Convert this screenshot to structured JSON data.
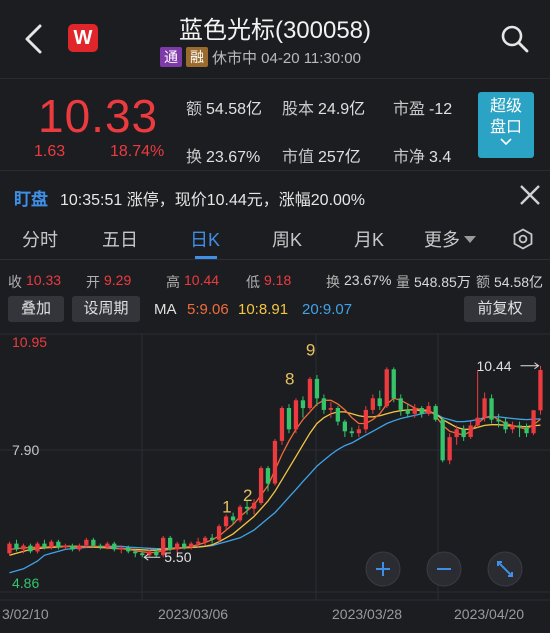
{
  "header": {
    "title": "蓝色光标(300058)",
    "logo": "W",
    "tags": [
      "通",
      "融"
    ],
    "status": "休市中 04-20 11:30:00"
  },
  "quote": {
    "price": "10.33",
    "change": "1.63",
    "change_pct": "18.74%",
    "stats": [
      {
        "label": "额",
        "value": "54.58亿"
      },
      {
        "label": "股本",
        "value": "24.9亿"
      },
      {
        "label": "市盈",
        "value": "-12"
      },
      {
        "label": "换",
        "value": "23.67%"
      },
      {
        "label": "市值",
        "value": "257亿"
      },
      {
        "label": "市净",
        "value": "3.4"
      }
    ],
    "super_button": [
      "超级",
      "盘口"
    ]
  },
  "watch": {
    "label": "盯盘",
    "text": "10:35:51 涨停，现价10.44元，涨幅20.00%"
  },
  "tabs": [
    "分时",
    "五日",
    "日K",
    "周K",
    "月K",
    "更多"
  ],
  "active_tab": "日K",
  "info": {
    "close_label": "收",
    "close": "10.33",
    "open_label": "开",
    "open": "9.29",
    "high_label": "高",
    "high": "10.44",
    "low_label": "低",
    "low": "9.18",
    "turnover_label": "换",
    "turnover": "23.67%",
    "volume_label": "量",
    "volume": "548.85万",
    "amount_label": "额",
    "amount": "54.58亿"
  },
  "controls": {
    "overlay_button": "叠加",
    "period_button": "设周期",
    "ma_label": "MA",
    "ma5": "5:9.06",
    "ma10": "10:8.91",
    "ma20": "20:9.07",
    "adjust_button": "前复权"
  },
  "colors": {
    "up": "#ec3b3f",
    "down": "#35c46a",
    "accent": "#3f8fe6",
    "ma5": "#f06d3a",
    "ma10": "#f5c542",
    "ma20": "#3fa3e8"
  },
  "chart_data": {
    "type": "candlestick",
    "y_labels": {
      "top": "10.95",
      "mid": "7.90",
      "bottom": "4.86"
    },
    "x_labels": [
      "3/02/10",
      "2023/03/06",
      "2023/03/28",
      "2023/04/20"
    ],
    "annotations": {
      "high_marker": "10.44",
      "low_marker": "5.50",
      "nine_turn": [
        "1",
        "2",
        "8",
        "9"
      ]
    },
    "ylim": [
      4.86,
      10.95
    ],
    "candles": [
      [
        5.6,
        5.85,
        5.55,
        5.9
      ],
      [
        5.85,
        5.7,
        5.65,
        5.95
      ],
      [
        5.7,
        5.8,
        5.6,
        5.85
      ],
      [
        5.8,
        5.65,
        5.6,
        5.85
      ],
      [
        5.65,
        5.85,
        5.6,
        5.9
      ],
      [
        5.85,
        5.75,
        5.7,
        5.95
      ],
      [
        5.75,
        5.9,
        5.7,
        5.95
      ],
      [
        5.9,
        5.75,
        5.7,
        5.95
      ],
      [
        5.75,
        5.8,
        5.7,
        5.85
      ],
      [
        5.8,
        5.7,
        5.65,
        5.85
      ],
      [
        5.7,
        5.8,
        5.65,
        5.85
      ],
      [
        5.8,
        5.95,
        5.75,
        6.0
      ],
      [
        5.95,
        5.8,
        5.75,
        6.0
      ],
      [
        5.8,
        5.75,
        5.7,
        5.85
      ],
      [
        5.75,
        5.85,
        5.7,
        5.9
      ],
      [
        5.85,
        5.7,
        5.65,
        5.9
      ],
      [
        5.7,
        5.75,
        5.6,
        5.8
      ],
      [
        5.75,
        5.65,
        5.6,
        5.8
      ],
      [
        5.65,
        5.6,
        5.5,
        5.7
      ],
      [
        5.6,
        5.55,
        5.5,
        5.65
      ],
      [
        5.55,
        5.65,
        5.5,
        5.7
      ],
      [
        5.65,
        5.55,
        5.5,
        5.7
      ],
      [
        5.55,
        6.0,
        5.5,
        6.05
      ],
      [
        6.0,
        5.7,
        5.65,
        6.05
      ],
      [
        5.7,
        5.85,
        5.6,
        5.9
      ],
      [
        5.85,
        5.75,
        5.7,
        5.95
      ],
      [
        5.75,
        5.85,
        5.7,
        5.9
      ],
      [
        5.85,
        5.9,
        5.75,
        6.0
      ],
      [
        5.9,
        6.0,
        5.8,
        6.05
      ],
      [
        6.0,
        5.95,
        5.85,
        6.1
      ],
      [
        5.95,
        6.3,
        5.9,
        6.35
      ],
      [
        6.3,
        6.55,
        6.2,
        6.6
      ],
      [
        6.55,
        6.45,
        6.35,
        6.65
      ],
      [
        6.45,
        6.8,
        6.4,
        6.85
      ],
      [
        6.8,
        6.75,
        6.6,
        6.95
      ],
      [
        6.75,
        6.9,
        6.6,
        7.0
      ],
      [
        6.9,
        7.8,
        6.85,
        7.85
      ],
      [
        7.8,
        7.4,
        7.2,
        7.85
      ],
      [
        7.4,
        8.5,
        7.35,
        8.55
      ],
      [
        8.5,
        9.35,
        8.4,
        9.4
      ],
      [
        9.35,
        8.8,
        8.7,
        9.45
      ],
      [
        8.8,
        9.55,
        8.7,
        9.6
      ],
      [
        9.55,
        9.35,
        9.1,
        9.65
      ],
      [
        9.35,
        10.1,
        9.3,
        10.15
      ],
      [
        10.1,
        9.6,
        9.4,
        10.2
      ],
      [
        9.6,
        9.3,
        9.2,
        9.7
      ],
      [
        9.3,
        9.35,
        9.1,
        9.5
      ],
      [
        9.35,
        9.0,
        8.9,
        9.4
      ],
      [
        9.0,
        8.75,
        8.6,
        9.05
      ],
      [
        8.75,
        8.7,
        8.6,
        8.85
      ],
      [
        8.7,
        8.8,
        8.6,
        8.9
      ],
      [
        8.8,
        9.3,
        8.7,
        9.4
      ],
      [
        9.3,
        9.6,
        9.2,
        9.7
      ],
      [
        9.6,
        9.4,
        9.3,
        9.8
      ],
      [
        9.4,
        10.35,
        9.35,
        10.4
      ],
      [
        10.35,
        9.6,
        9.5,
        10.4
      ],
      [
        9.6,
        9.3,
        9.15,
        9.7
      ],
      [
        9.3,
        9.2,
        9.1,
        9.45
      ],
      [
        9.2,
        9.35,
        9.1,
        9.45
      ],
      [
        9.35,
        9.2,
        9.1,
        9.4
      ],
      [
        9.2,
        9.4,
        9.15,
        9.5
      ],
      [
        9.4,
        9.05,
        9.0,
        9.45
      ],
      [
        9.05,
        8.0,
        7.95,
        9.1
      ],
      [
        8.0,
        8.6,
        7.9,
        8.7
      ],
      [
        8.6,
        8.8,
        8.4,
        8.9
      ],
      [
        8.8,
        8.6,
        8.5,
        8.9
      ],
      [
        8.6,
        8.9,
        8.55,
        9.0
      ],
      [
        8.9,
        9.1,
        8.85,
        10.3
      ],
      [
        9.1,
        9.6,
        9.0,
        9.75
      ],
      [
        9.6,
        9.05,
        8.95,
        9.7
      ],
      [
        9.05,
        9.0,
        8.85,
        9.2
      ],
      [
        9.0,
        8.8,
        8.7,
        9.1
      ],
      [
        8.8,
        8.9,
        8.7,
        9.0
      ],
      [
        8.9,
        8.85,
        8.6,
        9.0
      ],
      [
        8.85,
        8.7,
        8.6,
        8.95
      ],
      [
        8.7,
        9.29,
        8.65,
        9.3
      ],
      [
        9.29,
        10.33,
        9.18,
        10.44
      ]
    ],
    "ma20": [
      5.1,
      5.15,
      5.2,
      5.3,
      5.4,
      5.55,
      5.6,
      5.65,
      5.7,
      5.72,
      5.74,
      5.75,
      5.76,
      5.77,
      5.78,
      5.78,
      5.78,
      5.76,
      5.75,
      5.74,
      5.73,
      5.72,
      5.72,
      5.73,
      5.74,
      5.75,
      5.76,
      5.77,
      5.78,
      5.8,
      5.85,
      5.9,
      5.95,
      6.0,
      6.1,
      6.2,
      6.35,
      6.5,
      6.65,
      6.85,
      7.05,
      7.25,
      7.45,
      7.65,
      7.85,
      8.0,
      8.15,
      8.28,
      8.38,
      8.45,
      8.55,
      8.65,
      8.75,
      8.85,
      8.95,
      9.02,
      9.08,
      9.12,
      9.16,
      9.2,
      9.24,
      9.2,
      9.1,
      9.05,
      9.0,
      9.0,
      9.02,
      9.05,
      9.1,
      9.12,
      9.12,
      9.1,
      9.08,
      9.06,
      9.05,
      9.06,
      9.07
    ],
    "ma10": [
      5.55,
      5.6,
      5.65,
      5.7,
      5.72,
      5.74,
      5.75,
      5.76,
      5.78,
      5.78,
      5.78,
      5.77,
      5.76,
      5.75,
      5.74,
      5.73,
      5.72,
      5.71,
      5.7,
      5.69,
      5.68,
      5.68,
      5.7,
      5.72,
      5.73,
      5.74,
      5.75,
      5.76,
      5.78,
      5.82,
      5.9,
      6.0,
      6.1,
      6.25,
      6.4,
      6.55,
      6.75,
      6.95,
      7.2,
      7.5,
      7.8,
      8.1,
      8.4,
      8.7,
      8.95,
      9.1,
      9.2,
      9.25,
      9.25,
      9.2,
      9.15,
      9.12,
      9.12,
      9.15,
      9.2,
      9.25,
      9.28,
      9.3,
      9.3,
      9.28,
      9.27,
      9.2,
      9.05,
      8.95,
      8.85,
      8.8,
      8.8,
      8.85,
      8.9,
      8.92,
      8.92,
      8.9,
      8.88,
      8.87,
      8.87,
      8.89,
      8.91
    ],
    "ma5": [
      5.7,
      5.72,
      5.74,
      5.75,
      5.76,
      5.76,
      5.77,
      5.78,
      5.78,
      5.77,
      5.76,
      5.77,
      5.78,
      5.77,
      5.76,
      5.74,
      5.72,
      5.7,
      5.67,
      5.64,
      5.62,
      5.62,
      5.67,
      5.7,
      5.73,
      5.75,
      5.78,
      5.82,
      5.88,
      5.95,
      6.05,
      6.2,
      6.35,
      6.55,
      6.7,
      6.85,
      7.1,
      7.35,
      7.75,
      8.15,
      8.5,
      8.8,
      9.05,
      9.25,
      9.45,
      9.55,
      9.55,
      9.45,
      9.3,
      9.1,
      8.95,
      8.95,
      9.05,
      9.2,
      9.45,
      9.6,
      9.55,
      9.45,
      9.35,
      9.3,
      9.3,
      9.15,
      8.9,
      8.75,
      8.7,
      8.65,
      8.75,
      8.95,
      9.1,
      9.15,
      9.05,
      8.95,
      8.9,
      8.85,
      8.8,
      8.92,
      9.06
    ]
  }
}
